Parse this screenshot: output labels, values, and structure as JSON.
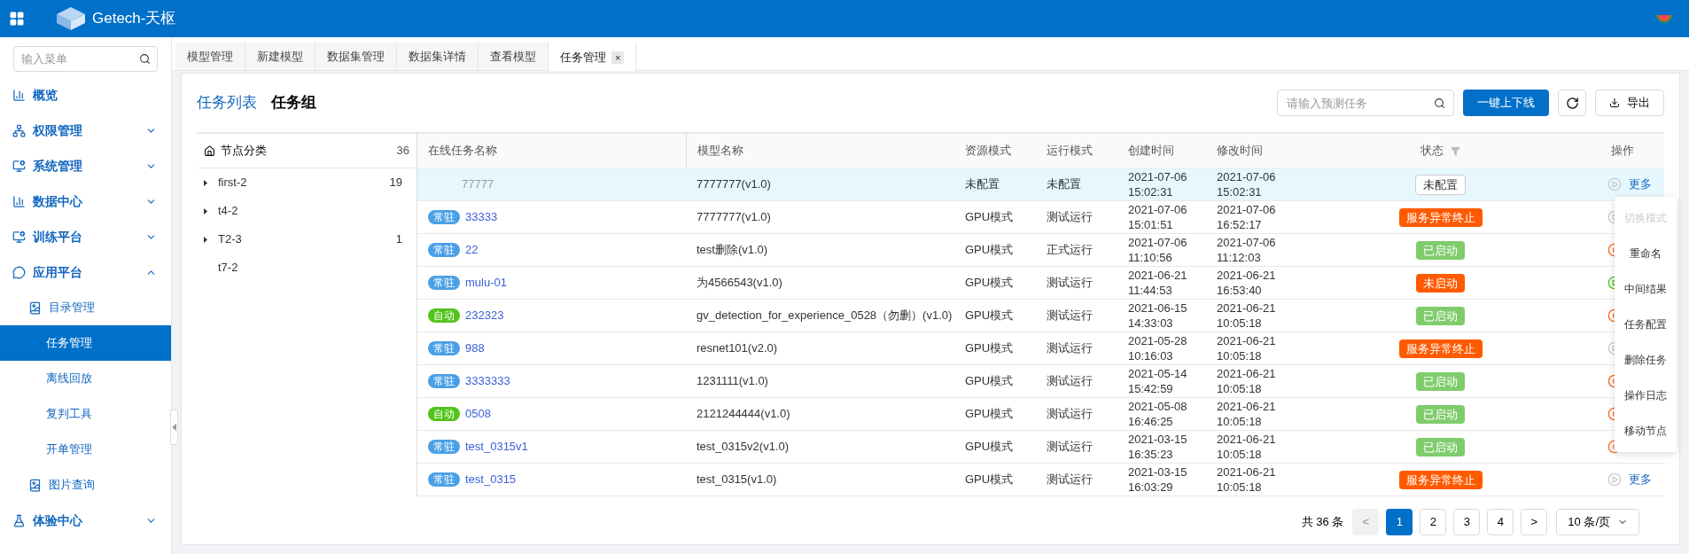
{
  "header": {
    "brand": "Getech-天枢"
  },
  "sidebar": {
    "search": {
      "placeholder": "输入菜单"
    },
    "items": [
      {
        "label": "概览",
        "expandable": false
      },
      {
        "label": "权限管理",
        "expandable": true,
        "expanded": false
      },
      {
        "label": "系统管理",
        "expandable": true,
        "expanded": false
      },
      {
        "label": "数据中心",
        "expandable": true,
        "expanded": false
      },
      {
        "label": "训练平台",
        "expandable": true,
        "expanded": false
      },
      {
        "label": "应用平台",
        "expandable": true,
        "expanded": true,
        "children": [
          {
            "label": "目录管理",
            "children": [
              {
                "label": "任务管理",
                "selected": true
              },
              {
                "label": "离线回放",
                "selected": false
              },
              {
                "label": "复判工具",
                "selected": false
              },
              {
                "label": "开单管理",
                "selected": false
              }
            ]
          },
          {
            "label": "图片查询"
          }
        ]
      },
      {
        "label": "体验中心",
        "expandable": true,
        "expanded": false
      }
    ]
  },
  "tabs": [
    {
      "label": "模型管理",
      "selected": false
    },
    {
      "label": "新建模型",
      "selected": false
    },
    {
      "label": "数据集管理",
      "selected": false
    },
    {
      "label": "数据集详情",
      "selected": false
    },
    {
      "label": "查看模型",
      "selected": false
    },
    {
      "label": "任务管理",
      "selected": true,
      "close": "×"
    }
  ],
  "view_tabs": [
    {
      "label": "任务列表",
      "selected": true
    },
    {
      "label": "任务组",
      "selected": false
    }
  ],
  "toolbar": {
    "search": {
      "placeholder": "请输入预测任务"
    },
    "primary": "一键上下线",
    "export": "导出"
  },
  "tree": {
    "title": "节点分类",
    "count": "36",
    "items": [
      {
        "label": "first-2",
        "count": "19",
        "expandable": true
      },
      {
        "label": "t4-2",
        "expandable": true
      },
      {
        "label": "T2-3",
        "count": "1",
        "expandable": true
      },
      {
        "label": "t7-2",
        "expandable": false
      }
    ]
  },
  "table": {
    "columns": [
      "在线任务名称",
      "模型名称",
      "资源模式",
      "运行模式",
      "创建时间",
      "修改时间",
      "状态",
      "操作"
    ],
    "rows": [
      {
        "selected": true,
        "name": "77777",
        "muted": true,
        "model": "7777777(v1.0)",
        "resource": "未配置",
        "run": "未配置",
        "created": [
          "2021-07-06",
          "15:02:31"
        ],
        "modified": [
          "2021-07-06",
          "15:02:31"
        ],
        "status": {
          "label": "未配置",
          "kind": "unset"
        },
        "action": {
          "kind": "play-off"
        },
        "more": "更多"
      },
      {
        "selected": false,
        "tag": {
          "label": "常驻",
          "color": "#4aa0e6"
        },
        "name": "33333",
        "muted": false,
        "model": "7777777(v1.0)",
        "resource": "GPU模式",
        "run": "测试运行",
        "created": [
          "2021-07-06",
          "15:01:51"
        ],
        "modified": [
          "2021-07-06",
          "16:52:17"
        ],
        "status": {
          "label": "服务异常终止",
          "kind": "error"
        },
        "action": {
          "kind": "play-off"
        }
      },
      {
        "selected": false,
        "tag": {
          "label": "常驻",
          "color": "#4aa0e6"
        },
        "name": "22",
        "muted": false,
        "model": "test删除(v1.0)",
        "resource": "GPU模式",
        "run": "正式运行",
        "created": [
          "2021-07-06",
          "11:10:56"
        ],
        "modified": [
          "2021-07-06",
          "11:12:03"
        ],
        "status": {
          "label": "已启动",
          "kind": "running"
        },
        "action": {
          "kind": "pause"
        }
      },
      {
        "selected": false,
        "tag": {
          "label": "常驻",
          "color": "#4aa0e6"
        },
        "name": "mulu-01",
        "muted": false,
        "model": "为4566543(v1.0)",
        "resource": "GPU模式",
        "run": "测试运行",
        "created": [
          "2021-06-21",
          "11:44:53"
        ],
        "modified": [
          "2021-06-21",
          "16:53:40"
        ],
        "status": {
          "label": "未启动",
          "kind": "error"
        },
        "action": {
          "kind": "play"
        }
      },
      {
        "selected": false,
        "tag": {
          "label": "自动",
          "color": "#52c41a"
        },
        "name": "232323",
        "muted": false,
        "model": "gv_detection_for_experience_0528（勿删）(v1.0)",
        "resource": "GPU模式",
        "run": "测试运行",
        "created": [
          "2021-06-15",
          "14:33:03"
        ],
        "modified": [
          "2021-06-21",
          "10:05:18"
        ],
        "status": {
          "label": "已启动",
          "kind": "running"
        },
        "action": {
          "kind": "pause"
        }
      },
      {
        "selected": false,
        "tag": {
          "label": "常驻",
          "color": "#4aa0e6"
        },
        "name": "988",
        "muted": false,
        "model": "resnet101(v2.0)",
        "resource": "GPU模式",
        "run": "测试运行",
        "created": [
          "2021-05-28",
          "10:16:03"
        ],
        "modified": [
          "2021-06-21",
          "10:05:18"
        ],
        "status": {
          "label": "服务异常终止",
          "kind": "error"
        },
        "action": {
          "kind": "play-off"
        }
      },
      {
        "selected": false,
        "tag": {
          "label": "常驻",
          "color": "#4aa0e6"
        },
        "name": "3333333",
        "muted": false,
        "model": "1231111(v1.0)",
        "resource": "GPU模式",
        "run": "测试运行",
        "created": [
          "2021-05-14",
          "15:42:59"
        ],
        "modified": [
          "2021-06-21",
          "10:05:18"
        ],
        "status": {
          "label": "已启动",
          "kind": "running"
        },
        "action": {
          "kind": "pause"
        }
      },
      {
        "selected": false,
        "tag": {
          "label": "自动",
          "color": "#52c41a"
        },
        "name": "0508",
        "muted": false,
        "model": "2121244444(v1.0)",
        "resource": "GPU模式",
        "run": "测试运行",
        "created": [
          "2021-05-08",
          "16:46:25"
        ],
        "modified": [
          "2021-06-21",
          "10:05:18"
        ],
        "status": {
          "label": "已启动",
          "kind": "running"
        },
        "action": {
          "kind": "pause"
        }
      },
      {
        "selected": false,
        "tag": {
          "label": "常驻",
          "color": "#4aa0e6"
        },
        "name": "test_0315v1",
        "muted": false,
        "model": "test_0315v2(v1.0)",
        "resource": "GPU模式",
        "run": "测试运行",
        "created": [
          "2021-03-15",
          "16:35:23"
        ],
        "modified": [
          "2021-06-21",
          "10:05:18"
        ],
        "status": {
          "label": "已启动",
          "kind": "running"
        },
        "action": {
          "kind": "pause"
        }
      },
      {
        "selected": false,
        "tag": {
          "label": "常驻",
          "color": "#4aa0e6"
        },
        "name": "test_0315",
        "muted": false,
        "model": "test_0315(v1.0)",
        "resource": "GPU模式",
        "run": "测试运行",
        "created": [
          "2021-03-15",
          "16:03:29"
        ],
        "modified": [
          "2021-06-21",
          "10:05:18"
        ],
        "status": {
          "label": "服务异常终止",
          "kind": "error"
        },
        "action": {
          "kind": "play-off"
        },
        "more": "更多"
      }
    ]
  },
  "menu": [
    {
      "label": "切换模式",
      "disabled": true
    },
    {
      "label": "重命名",
      "disabled": false
    },
    {
      "label": "中间结果",
      "disabled": false
    },
    {
      "label": "任务配置",
      "disabled": false
    },
    {
      "label": "删除任务",
      "disabled": false
    },
    {
      "label": "操作日志",
      "disabled": false
    },
    {
      "label": "移动节点",
      "disabled": false
    }
  ],
  "pagination": {
    "total": "共 36 条",
    "prev": "<",
    "next": ">",
    "pages": [
      {
        "label": "1",
        "selected": true
      },
      {
        "label": "2",
        "selected": false
      },
      {
        "label": "3",
        "selected": false
      },
      {
        "label": "4",
        "selected": false
      }
    ],
    "prev_disabled": true,
    "page_size": "10 条/页"
  }
}
